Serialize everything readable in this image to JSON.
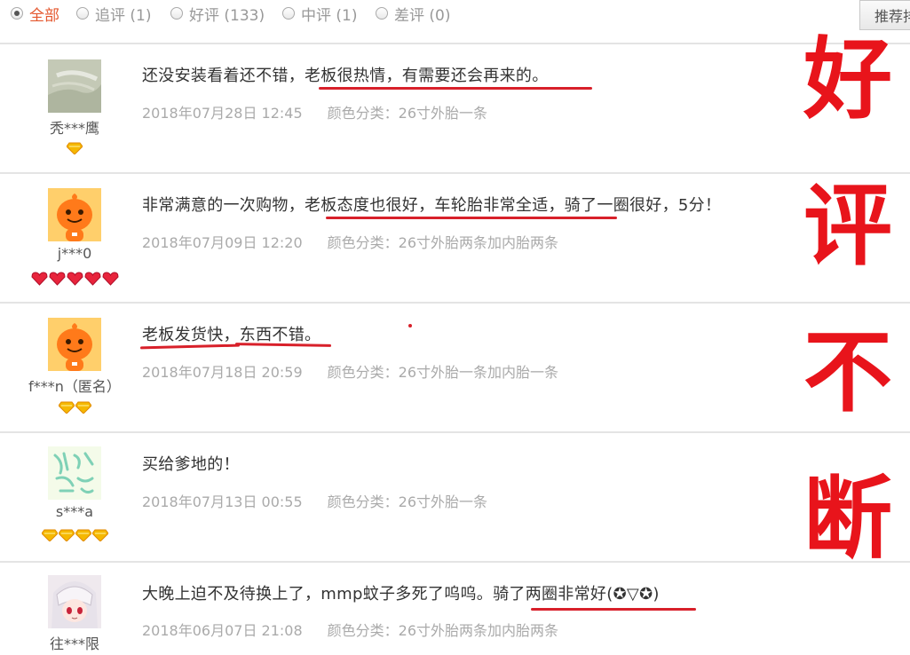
{
  "filters": {
    "all": "全部",
    "followup": "追评 (1)",
    "positive": "好评 (133)",
    "neutral": "中评 (1)",
    "negative": "差评 (0)"
  },
  "sort_button": "推荐排序",
  "reviews": [
    {
      "user": "秃***鹰",
      "text": "还没安装看着还不错，老板很热情，有需要还会再来的。",
      "date": "2018年07月28日 12:45",
      "sku": "颜色分类：26寸外胎一条",
      "badges": 1,
      "badge_type": "gold-diamond"
    },
    {
      "user": "j***0",
      "text": "非常满意的一次购物，老板态度也很好，车轮胎非常全适，骑了一圈很好，5分！",
      "date": "2018年07月09日 12:20",
      "sku": "颜色分类：26寸外胎两条加内胎两条",
      "badges": 5,
      "badge_type": "red-heart"
    },
    {
      "user": "f***n（匿名）",
      "text": "老板发货快，东西不错。",
      "date": "2018年07月18日 20:59",
      "sku": "颜色分类：26寸外胎一条加内胎一条",
      "badges": 2,
      "badge_type": "gold-diamond"
    },
    {
      "user": "s***a",
      "text": "买给爹地的！",
      "date": "2018年07月13日 00:55",
      "sku": "颜色分类：26寸外胎一条",
      "badges": 4,
      "badge_type": "gold-diamond"
    },
    {
      "user": "往***限",
      "text": "大晚上迫不及待换上了，mmp蚊子多死了呜呜。骑了两圈非常好(✪▽✪)",
      "date": "2018年06月07日 21:08",
      "sku": "颜色分类：26寸外胎两条加内胎两条",
      "badges": 0,
      "badge_type": "gold-diamond"
    }
  ],
  "overlay_chars": [
    "好",
    "评",
    "不",
    "断"
  ],
  "colors": {
    "accent": "#e4572e",
    "overlay_red": "#e8141b",
    "underline_red": "#d8202a",
    "meta_gray": "#aaaaaa"
  }
}
